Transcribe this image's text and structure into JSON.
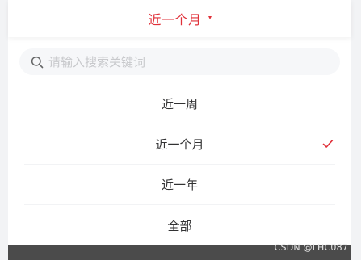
{
  "header": {
    "title": "近一个月"
  },
  "search": {
    "placeholder": "请输入搜索关键词"
  },
  "options": [
    {
      "label": "近一周",
      "selected": false
    },
    {
      "label": "近一个月",
      "selected": true
    },
    {
      "label": "近一年",
      "selected": false
    },
    {
      "label": "全部",
      "selected": false
    }
  ],
  "watermark": "CSDN @LHC087",
  "colors": {
    "accent": "#e0313a",
    "text": "#323233",
    "placeholder": "#c8c9cc",
    "search_bg": "#f6f7f9",
    "overlay": "#4b4b4b"
  }
}
